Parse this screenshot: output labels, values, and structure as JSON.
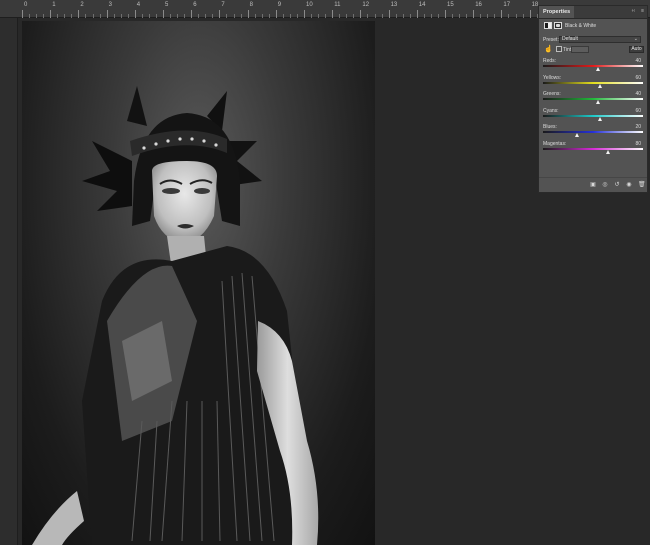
{
  "ruler": {
    "labels": [
      "0",
      "1",
      "2",
      "3",
      "4",
      "5",
      "6",
      "7",
      "8",
      "9",
      "10",
      "11",
      "12",
      "13",
      "14",
      "15",
      "16",
      "17",
      "18"
    ]
  },
  "panel": {
    "tab_label": "Properties",
    "collapse_glyph": "‹‹",
    "menu_glyph": "≡",
    "adjustment_title": "Black & White",
    "preset_label": "Preset:",
    "preset_value": "Default",
    "tint_label": "Tint",
    "auto_label": "Auto",
    "sliders": [
      {
        "label": "Reds:",
        "value": "40",
        "fraction": 0.55,
        "gradient": "linear-gradient(90deg,#1a1a1a,#e01b1b,#ffffff)"
      },
      {
        "label": "Yellows:",
        "value": "60",
        "fraction": 0.57,
        "gradient": "linear-gradient(90deg,#1a1a1a,#e3de1e,#ffffff)"
      },
      {
        "label": "Greens:",
        "value": "40",
        "fraction": 0.55,
        "gradient": "linear-gradient(90deg,#1a1a1a,#22b93a,#ffffff)"
      },
      {
        "label": "Cyans:",
        "value": "60",
        "fraction": 0.57,
        "gradient": "linear-gradient(90deg,#1a1a1a,#1ec9c9,#ffffff)"
      },
      {
        "label": "Blues:",
        "value": "20",
        "fraction": 0.34,
        "gradient": "linear-gradient(90deg,#1a1a1a,#2530d8,#ffffff)"
      },
      {
        "label": "Magentas:",
        "value": "80",
        "fraction": 0.65,
        "gradient": "linear-gradient(90deg,#1a1a1a,#d62bd6,#ffffff)"
      }
    ],
    "footer_icons": [
      "clip-to-layer-icon",
      "view-previous-state-icon",
      "reset-icon",
      "visibility-eye-icon",
      "trash-icon"
    ]
  }
}
